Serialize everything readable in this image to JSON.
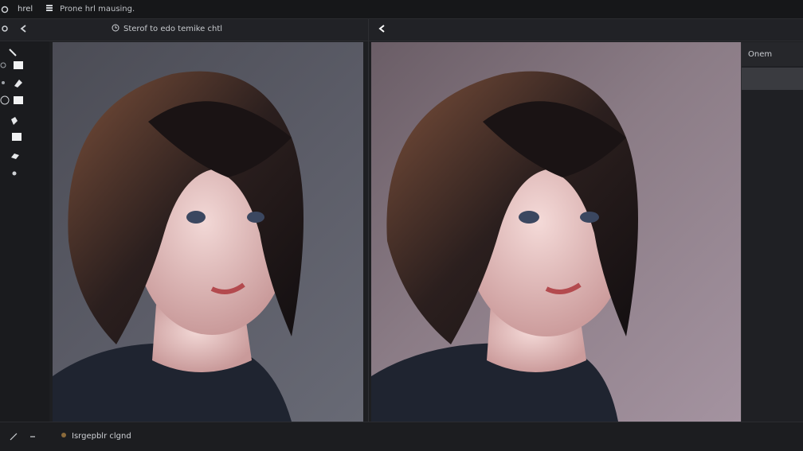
{
  "app": {
    "title": "Prone hrl mausing."
  },
  "topbar": {
    "menu_label": "hrel",
    "grid_icon": "grid-icon",
    "logo_icon": "app-logo-icon"
  },
  "subbar": {
    "status_text": "Sterof to edo temike chtl",
    "status_icon": "clock-icon",
    "back_icon": "back-arrow-icon",
    "settings_icon": "gear-icon"
  },
  "panels": {
    "right_header": "Onem"
  },
  "bottom": {
    "info_text": "Isrgepblr clgnd",
    "info_icon": "dot-icon"
  },
  "colors": {
    "bg": "#1e1f22",
    "panel": "#212226",
    "accent": "#cfd2d6"
  }
}
